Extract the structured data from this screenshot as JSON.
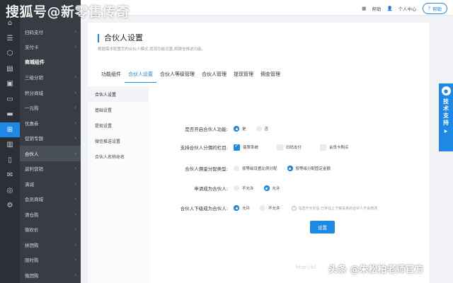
{
  "watermark_top": "搜狐号@新零售传奇",
  "watermark_bottom": "头条 @朱松柏老师官方",
  "watermark_url": "http://bl",
  "topbar": {
    "help_label": "帮助",
    "user_label": "个人中心",
    "btn_help": "帮助"
  },
  "topbar_right": {
    "help": "帮助",
    "user": "个人中心",
    "support": "帮助"
  },
  "rail_icons": [
    "home-icon",
    "list-icon",
    "box-icon",
    "doc-icon",
    "image-icon",
    "wallet-icon",
    "card-icon",
    "grid-icon",
    "chart-icon",
    "phone-icon",
    "message-icon",
    "swirl-icon",
    "gear-icon"
  ],
  "menu": [
    {
      "label": "扫码支付",
      "chev": true
    },
    {
      "label": "支付卡",
      "chev": true
    },
    {
      "label": "商城组件",
      "section": true
    },
    {
      "label": "三级分销",
      "chev": true
    },
    {
      "label": "积分商城",
      "chev": true
    },
    {
      "label": "一元购",
      "chev": true
    },
    {
      "label": "优惠券",
      "chev": true
    },
    {
      "label": "促销专题",
      "chev": true
    },
    {
      "label": "合伙人",
      "chev": true,
      "active": true
    },
    {
      "label": "返利营销",
      "chev": true
    },
    {
      "label": "满减",
      "chev": true
    },
    {
      "label": "会员商城",
      "chev": true
    },
    {
      "label": "清仓购",
      "chev": true
    },
    {
      "label": "微砍价",
      "chev": true
    },
    {
      "label": "拼团购",
      "chev": true
    },
    {
      "label": "限时购",
      "chev": true
    },
    {
      "label": "微团购",
      "chev": true
    }
  ],
  "page": {
    "title": "合伙人设置",
    "description": "根据需求配置您的合伙人模式,提现功能设置,和微信推送功能。"
  },
  "tabs": [
    "功能组件",
    "合伙人设置",
    "合伙人等级管理",
    "合伙人管理",
    "提现管理",
    "佣金管理"
  ],
  "active_tab": 1,
  "subnav": [
    "合伙人设置",
    "基础设置",
    "提现设置",
    "微信推送设置",
    "合伙人名称命名"
  ],
  "form": {
    "enable": {
      "label": "是否开启合伙人功能:",
      "options": [
        "是",
        "否"
      ],
      "selected": 0
    },
    "column": {
      "label": "支持合伙人分佣的栏目:",
      "options": [
        "翡翠系统",
        "扫码支付",
        "会员卡购买"
      ],
      "checked": [
        true,
        false,
        false
      ]
    },
    "commission_type": {
      "label": "合伙人佣金分配类型:",
      "options": [
        "按等级设置比例分配",
        "按等级分配固定金额"
      ],
      "selected": 1
    },
    "apply": {
      "label": "申请成为合伙人:",
      "options": [
        "不允许",
        "允许"
      ],
      "selected": 1
    },
    "downline": {
      "label": "合伙人下级成为合伙人:",
      "options": [
        "允许",
        "不允许"
      ],
      "selected": 0,
      "hint": "勾选不允许后,已存在上下级关系的合伙人不会修改"
    },
    "save_label": "设置"
  },
  "support": {
    "label": "技术支持"
  }
}
